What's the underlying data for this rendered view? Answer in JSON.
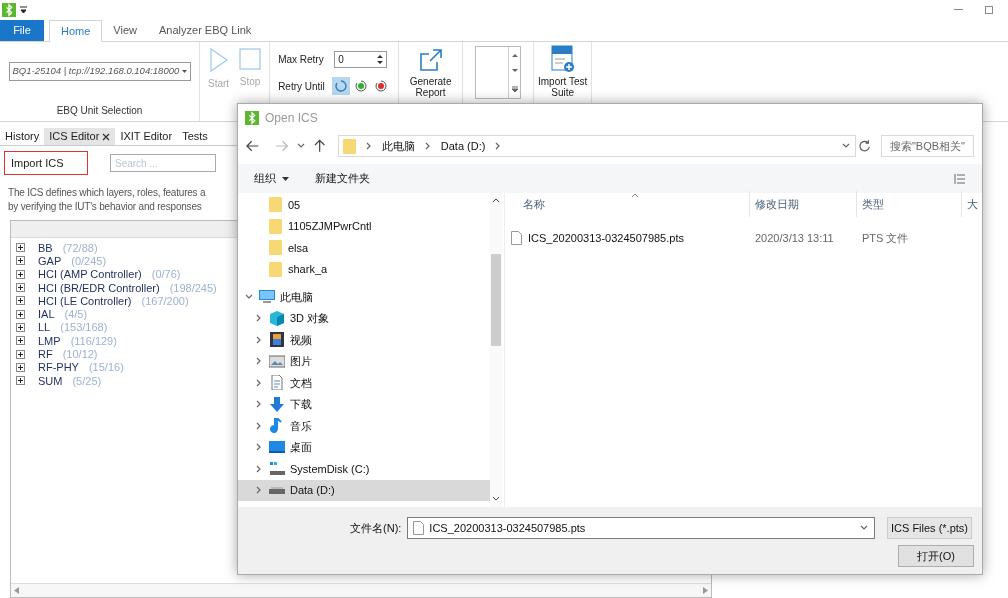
{
  "ribbon_tabs": [
    {
      "label": "File",
      "kind": "file",
      "selected": false
    },
    {
      "label": "Home",
      "kind": "tab",
      "selected": true
    },
    {
      "label": "View",
      "kind": "tab",
      "selected": false
    },
    {
      "label": "Analyzer EBQ Link",
      "kind": "tab",
      "selected": false
    }
  ],
  "ribbon": {
    "unit_selection": {
      "value": "BQ1-25104 | tcp://192.168.0.104:18000",
      "group_label": "EBQ Unit Selection"
    },
    "run_buttons": [
      {
        "label": "Start",
        "kind": "start",
        "disabled": true
      },
      {
        "label": "Stop",
        "kind": "stop",
        "disabled": true
      }
    ],
    "max_retry": {
      "label": "Max Retry",
      "value": "0"
    },
    "retry_until": {
      "label": "Retry Until",
      "options": [
        {
          "kind": "any",
          "selected": true
        },
        {
          "kind": "pass",
          "selected": false
        },
        {
          "kind": "fail",
          "selected": false
        }
      ]
    },
    "generate_report": {
      "label": "Generate Report"
    },
    "import_test_suite": {
      "label": "Import Test Suite"
    }
  },
  "doc_tabs": [
    {
      "label": "History",
      "selected": false,
      "closable": false
    },
    {
      "label": "ICS Editor",
      "selected": true,
      "closable": true
    },
    {
      "label": "IXIT Editor",
      "selected": false,
      "closable": false
    },
    {
      "label": "Tests",
      "selected": false,
      "closable": false
    }
  ],
  "ics_editor": {
    "import_button": "Import ICS",
    "search": {
      "placeholder": "Search ..."
    },
    "description": [
      "The ICS defines which layers, roles, features a",
      "by verifying the IUT's behavior and responses"
    ],
    "tree": [
      {
        "name": "BB",
        "count": "(72/88)",
        "expanded": false
      },
      {
        "name": "GAP",
        "count": "(0/245)",
        "expanded": false
      },
      {
        "name": "HCI (AMP Controller)",
        "count": "(0/76)",
        "expanded": false
      },
      {
        "name": "HCI (BR/EDR Controller)",
        "count": "(198/245)",
        "expanded": false
      },
      {
        "name": "HCI (LE Controller)",
        "count": "(167/200)",
        "expanded": false
      },
      {
        "name": "IAL",
        "count": "(4/5)",
        "expanded": false
      },
      {
        "name": "LL",
        "count": "(153/168)",
        "expanded": false
      },
      {
        "name": "LMP",
        "count": "(116/129)",
        "expanded": false
      },
      {
        "name": "RF",
        "count": "(10/12)",
        "expanded": false
      },
      {
        "name": "RF-PHY",
        "count": "(15/16)",
        "expanded": false
      },
      {
        "name": "SUM",
        "count": "(5/25)",
        "expanded": false
      }
    ]
  },
  "dialog": {
    "title": "Open ICS",
    "breadcrumb": [
      "此电脑",
      "Data (D:)"
    ],
    "search": {
      "placeholder": "搜索\"BQB相关\""
    },
    "toolbar": [
      {
        "label": "组织",
        "kind": "menu"
      },
      {
        "label": "新建文件夹",
        "kind": "button"
      }
    ],
    "quick_folders": [
      {
        "name": "05"
      },
      {
        "name": "1105ZJMPwrCntl"
      },
      {
        "name": "elsa"
      },
      {
        "name": "shark_a"
      }
    ],
    "tree": [
      {
        "name": "此电脑",
        "kind": "computer",
        "expanded": true,
        "selected": false,
        "children": [
          {
            "name": "3D 对象",
            "kind": "objects3d",
            "expanded": false,
            "selected": false
          },
          {
            "name": "视频",
            "kind": "video",
            "expanded": false,
            "selected": false
          },
          {
            "name": "图片",
            "kind": "picture",
            "expanded": false,
            "selected": false
          },
          {
            "name": "文档",
            "kind": "document",
            "expanded": false,
            "selected": false
          },
          {
            "name": "下载",
            "kind": "download",
            "expanded": false,
            "selected": false
          },
          {
            "name": "音乐",
            "kind": "music",
            "expanded": false,
            "selected": false
          },
          {
            "name": "桌面",
            "kind": "desktop",
            "expanded": false,
            "selected": false
          },
          {
            "name": "SystemDisk (C:)",
            "kind": "systemdisk",
            "expanded": false,
            "selected": false
          },
          {
            "name": "Data (D:)",
            "kind": "drive",
            "expanded": false,
            "selected": true
          }
        ]
      }
    ],
    "columns": [
      "名称",
      "修改日期",
      "类型",
      "大"
    ],
    "files": [
      {
        "name": "ICS_20200313-0324507985.pts",
        "modified": "2020/3/13 13:11",
        "type": "PTS 文件"
      }
    ],
    "file_name": {
      "label": "文件名(N):",
      "value": "ICS_20200313-0324507985.pts"
    },
    "filter": "ICS Files (*.pts)",
    "open_button": "打开(O)"
  }
}
